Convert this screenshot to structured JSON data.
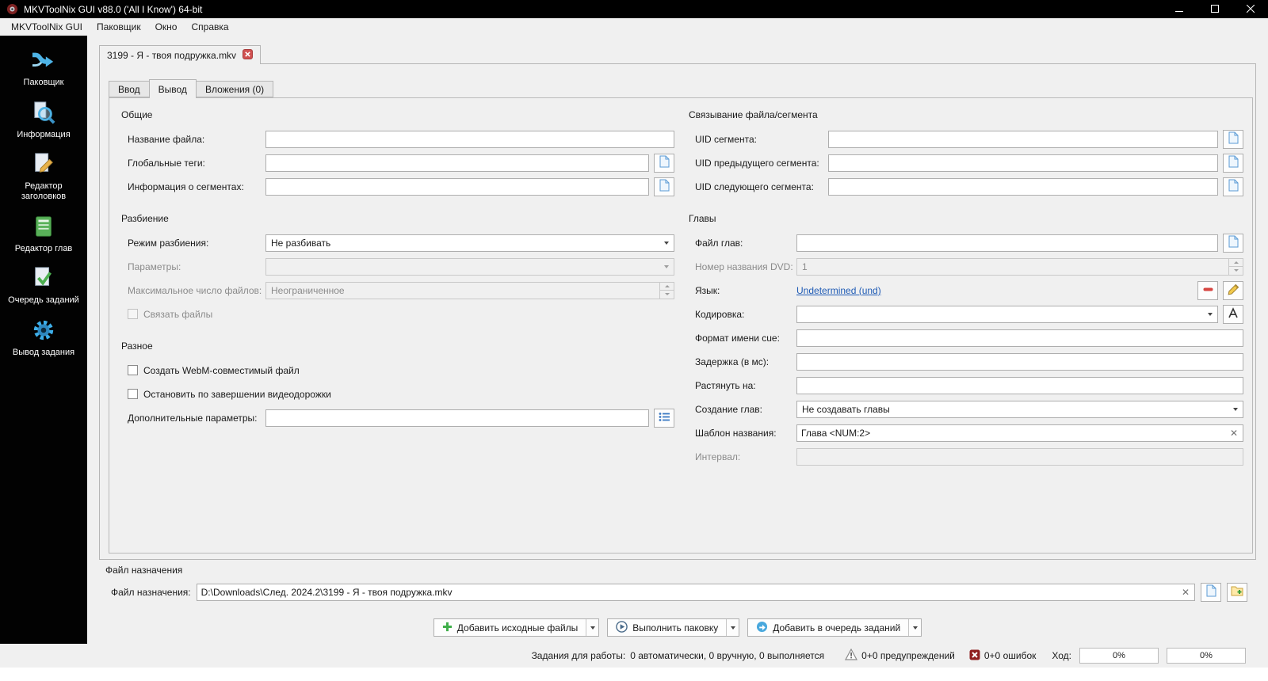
{
  "window": {
    "title": "MKVToolNix GUI v88.0 ('All I Know') 64-bit"
  },
  "menu": {
    "items": [
      "MKVToolNix GUI",
      "Паковщик",
      "Окно",
      "Справка"
    ]
  },
  "sidebar": {
    "items": [
      {
        "label": "Паковщик"
      },
      {
        "label": "Информация"
      },
      {
        "label": "Редактор заголовков"
      },
      {
        "label": "Редактор глав"
      },
      {
        "label": "Очередь заданий"
      },
      {
        "label": "Вывод задания"
      }
    ]
  },
  "file_tab": {
    "label": "3199 - Я - твоя подружка.mkv"
  },
  "subtabs": {
    "input": "Ввод",
    "output": "Вывод",
    "attachments": "Вложения (0)"
  },
  "general": {
    "title": "Общие",
    "file_title": {
      "label": "Название файла:",
      "value": ""
    },
    "global_tags": {
      "label": "Глобальные теги:",
      "value": ""
    },
    "segment_info": {
      "label": "Информация о сегментах:",
      "value": ""
    }
  },
  "splitting": {
    "title": "Разбиение",
    "mode": {
      "label": "Режим разбиения:",
      "value": "Не разбивать"
    },
    "parameters": {
      "label": "Параметры:",
      "value": ""
    },
    "max_files": {
      "label": "Максимальное число файлов:",
      "value": "Неограниченное"
    },
    "link_files": {
      "label": "Связать файлы",
      "checked": false
    }
  },
  "misc": {
    "title": "Разное",
    "webm": {
      "label": "Создать WebM-совместимый файл",
      "checked": false
    },
    "stop_after_video": {
      "label": "Остановить по завершении видеодорожки",
      "checked": false
    },
    "additional_params": {
      "label": "Дополнительные параметры:",
      "value": ""
    }
  },
  "linking": {
    "title": "Связывание файла/сегмента",
    "segment_uid": {
      "label": "UID сегмента:",
      "value": ""
    },
    "previous_uid": {
      "label": "UID предыдущего сегмента:",
      "value": ""
    },
    "next_uid": {
      "label": "UID следующего сегмента:",
      "value": ""
    }
  },
  "chapters": {
    "title": "Главы",
    "file": {
      "label": "Файл глав:",
      "value": ""
    },
    "dvd_title_number": {
      "label": "Номер названия DVD:",
      "value": "1"
    },
    "language": {
      "label": "Язык:",
      "value": "Undetermined (und)"
    },
    "character_set": {
      "label": "Кодировка:",
      "value": ""
    },
    "cue_name_format": {
      "label": "Формат имени cue:",
      "value": ""
    },
    "delay": {
      "label": "Задержка (в мс):",
      "value": ""
    },
    "stretch_by": {
      "label": "Растянуть на:",
      "value": ""
    },
    "generation": {
      "label": "Создание глав:",
      "value": "Не создавать главы"
    },
    "name_template": {
      "label": "Шаблон названия:",
      "value": "Глава <NUM:2>"
    },
    "interval": {
      "label": "Интервал:",
      "value": ""
    }
  },
  "destination": {
    "title": "Файл назначения",
    "label": "Файл назначения:",
    "value": "D:\\Downloads\\След. 2024.2\\3199 - Я - твоя подружка.mkv"
  },
  "actions": {
    "add_source_files": "Добавить исходные файлы",
    "start_muxing": "Выполнить паковку",
    "add_to_job_queue": "Добавить в очередь заданий"
  },
  "statusbar": {
    "jobs_label": "Задания для работы:",
    "jobs_value": "0 автоматически, 0 вручную, 0 выполняется",
    "warnings": "0+0 предупреждений",
    "errors": "0+0 ошибок",
    "progress_label": "Ход:",
    "progress_current": "0%",
    "progress_total": "0%"
  }
}
